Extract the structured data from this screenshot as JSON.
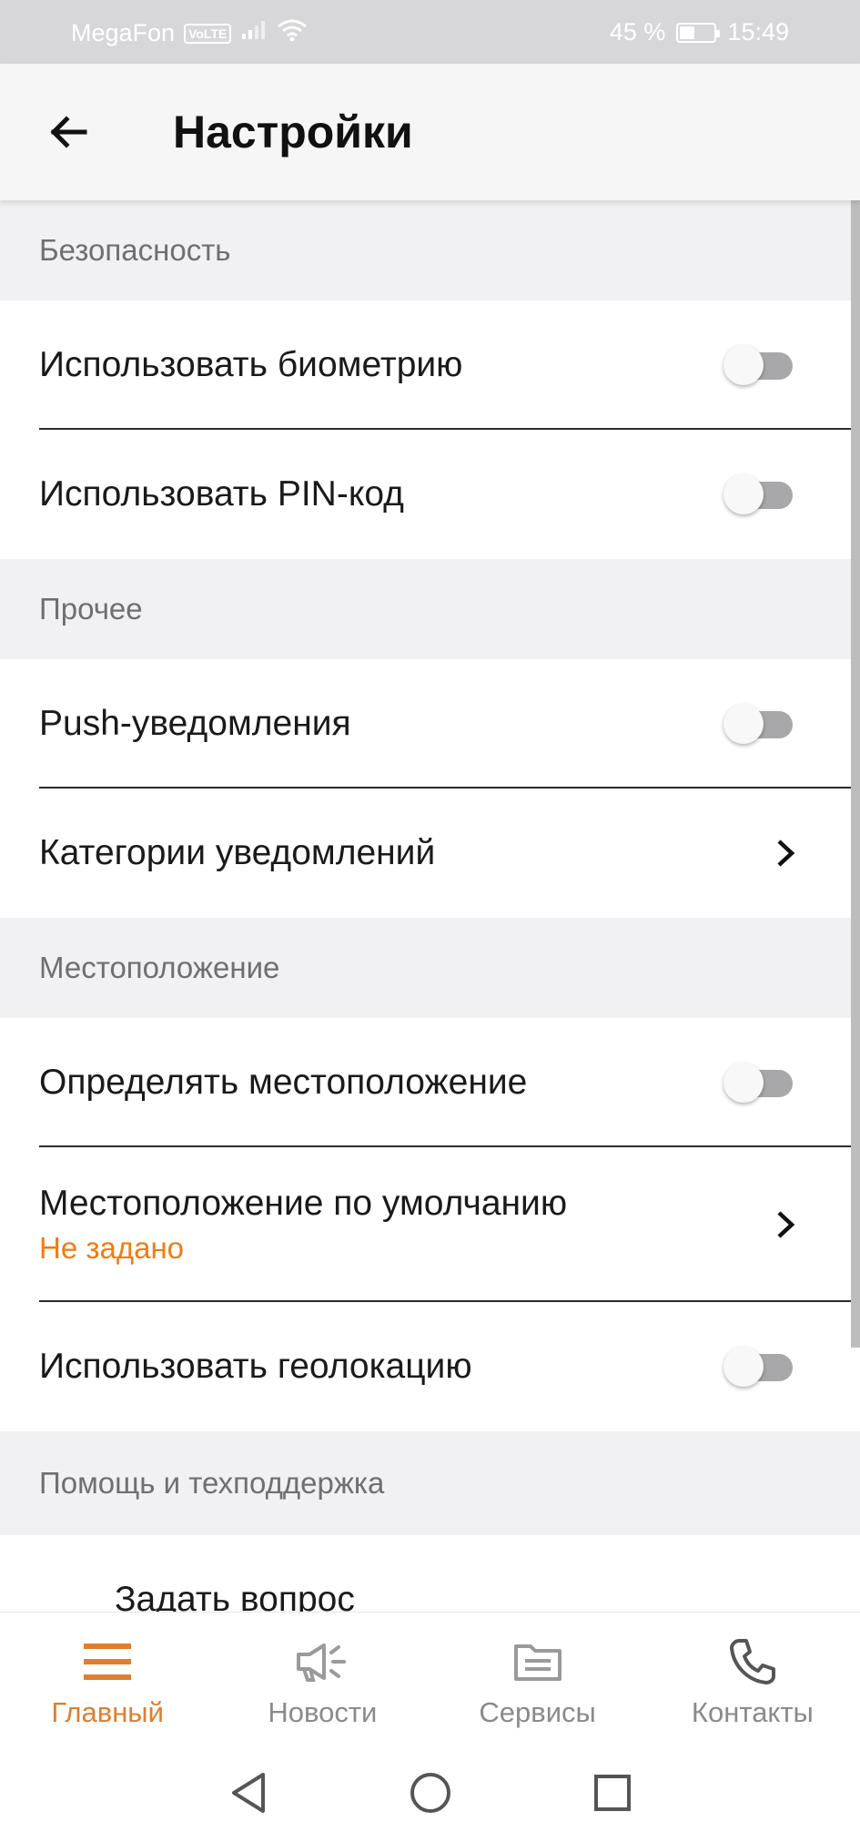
{
  "status_bar": {
    "carrier": "MegaFon",
    "volte": "VoLTE",
    "battery_percent": "45 %",
    "battery_level": 0.45,
    "time": "15:49"
  },
  "app_bar": {
    "title": "Настройки"
  },
  "sections": {
    "security": {
      "header": "Безопасность",
      "biometry": {
        "label": "Использовать биометрию",
        "enabled": false
      },
      "pin": {
        "label": "Использовать PIN-код",
        "enabled": false
      }
    },
    "other": {
      "header": "Прочее",
      "push": {
        "label": "Push-уведомления",
        "enabled": false
      },
      "categories": {
        "label": "Категории уведомлений"
      }
    },
    "location": {
      "header": "Местоположение",
      "detect": {
        "label": "Определять местоположение",
        "enabled": false
      },
      "default": {
        "label": "Местоположение по умолчанию",
        "value": "Не задано"
      },
      "geolocation": {
        "label": "Использовать геолокацию",
        "enabled": false
      }
    },
    "help": {
      "header": "Помощь и техподдержка",
      "ask": {
        "label": "Задать вопрос"
      }
    }
  },
  "bottom_nav": {
    "items": [
      {
        "label": "Главный",
        "icon": "menu-icon",
        "active": true
      },
      {
        "label": "Новости",
        "icon": "megaphone-icon",
        "active": false
      },
      {
        "label": "Сервисы",
        "icon": "folder-icon",
        "active": false
      },
      {
        "label": "Контакты",
        "icon": "phone-icon",
        "active": false
      }
    ]
  },
  "colors": {
    "accent": "#e07e2e",
    "subtitle_orange": "#ef7d14",
    "section_bg": "#f1f1f3",
    "status_bar_bg": "#d7d7d9"
  }
}
